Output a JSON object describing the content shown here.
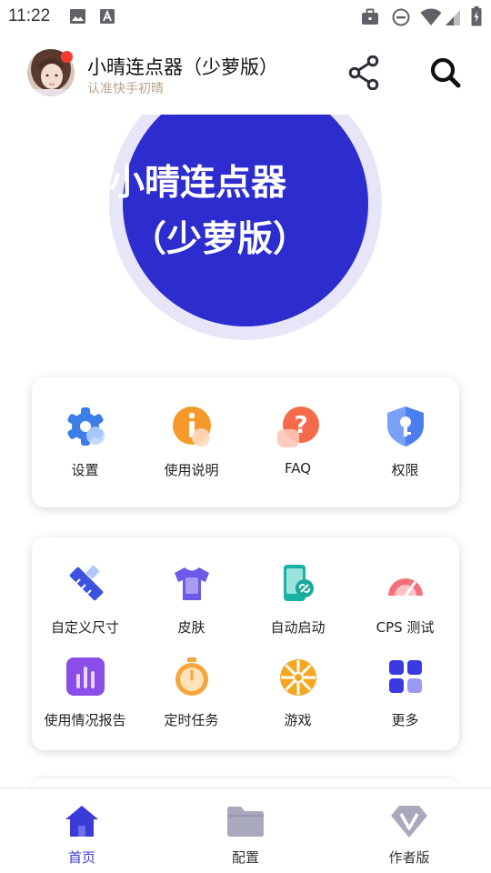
{
  "status_bar": {
    "time": "11:22",
    "icons": [
      "image-icon",
      "text-icon",
      "briefcase-icon",
      "do-not-disturb-icon",
      "wifi-icon",
      "signal-icon",
      "battery-charging-icon"
    ]
  },
  "header": {
    "title": "小晴连点器（少萝版）",
    "subtitle": "认准快手初晴",
    "share_icon": "share-icon",
    "search_icon": "search-icon"
  },
  "hero": {
    "line1": "小晴连点器",
    "line2": "（少萝版）",
    "circle_color": "#2c2ccf",
    "ring_color": "#e6e6f8"
  },
  "quick_actions": [
    {
      "label": "设置",
      "icon": "gear-icon"
    },
    {
      "label": "使用说明",
      "icon": "info-icon"
    },
    {
      "label": "FAQ",
      "icon": "question-icon"
    },
    {
      "label": "权限",
      "icon": "shield-key-icon"
    }
  ],
  "features": [
    {
      "label": "自定义尺寸",
      "icon": "ruler-pencil-icon"
    },
    {
      "label": "皮肤",
      "icon": "tshirt-icon"
    },
    {
      "label": "自动启动",
      "icon": "phone-link-icon"
    },
    {
      "label": "CPS 测试",
      "icon": "speedometer-icon"
    },
    {
      "label": "使用情况报告",
      "icon": "bar-chart-icon"
    },
    {
      "label": "定时任务",
      "icon": "stopwatch-icon"
    },
    {
      "label": "游戏",
      "icon": "wheel-icon"
    },
    {
      "label": "更多",
      "icon": "grid-more-icon"
    }
  ],
  "bottom_nav": {
    "items": [
      {
        "label": "首页",
        "icon": "home-icon",
        "active": true
      },
      {
        "label": "配置",
        "icon": "folder-icon",
        "active": false
      },
      {
        "label": "作者版",
        "icon": "diamond-v-icon",
        "active": false
      }
    ],
    "active_color": "#3b3bd8",
    "inactive_icon_color": "#a9a9bd"
  }
}
